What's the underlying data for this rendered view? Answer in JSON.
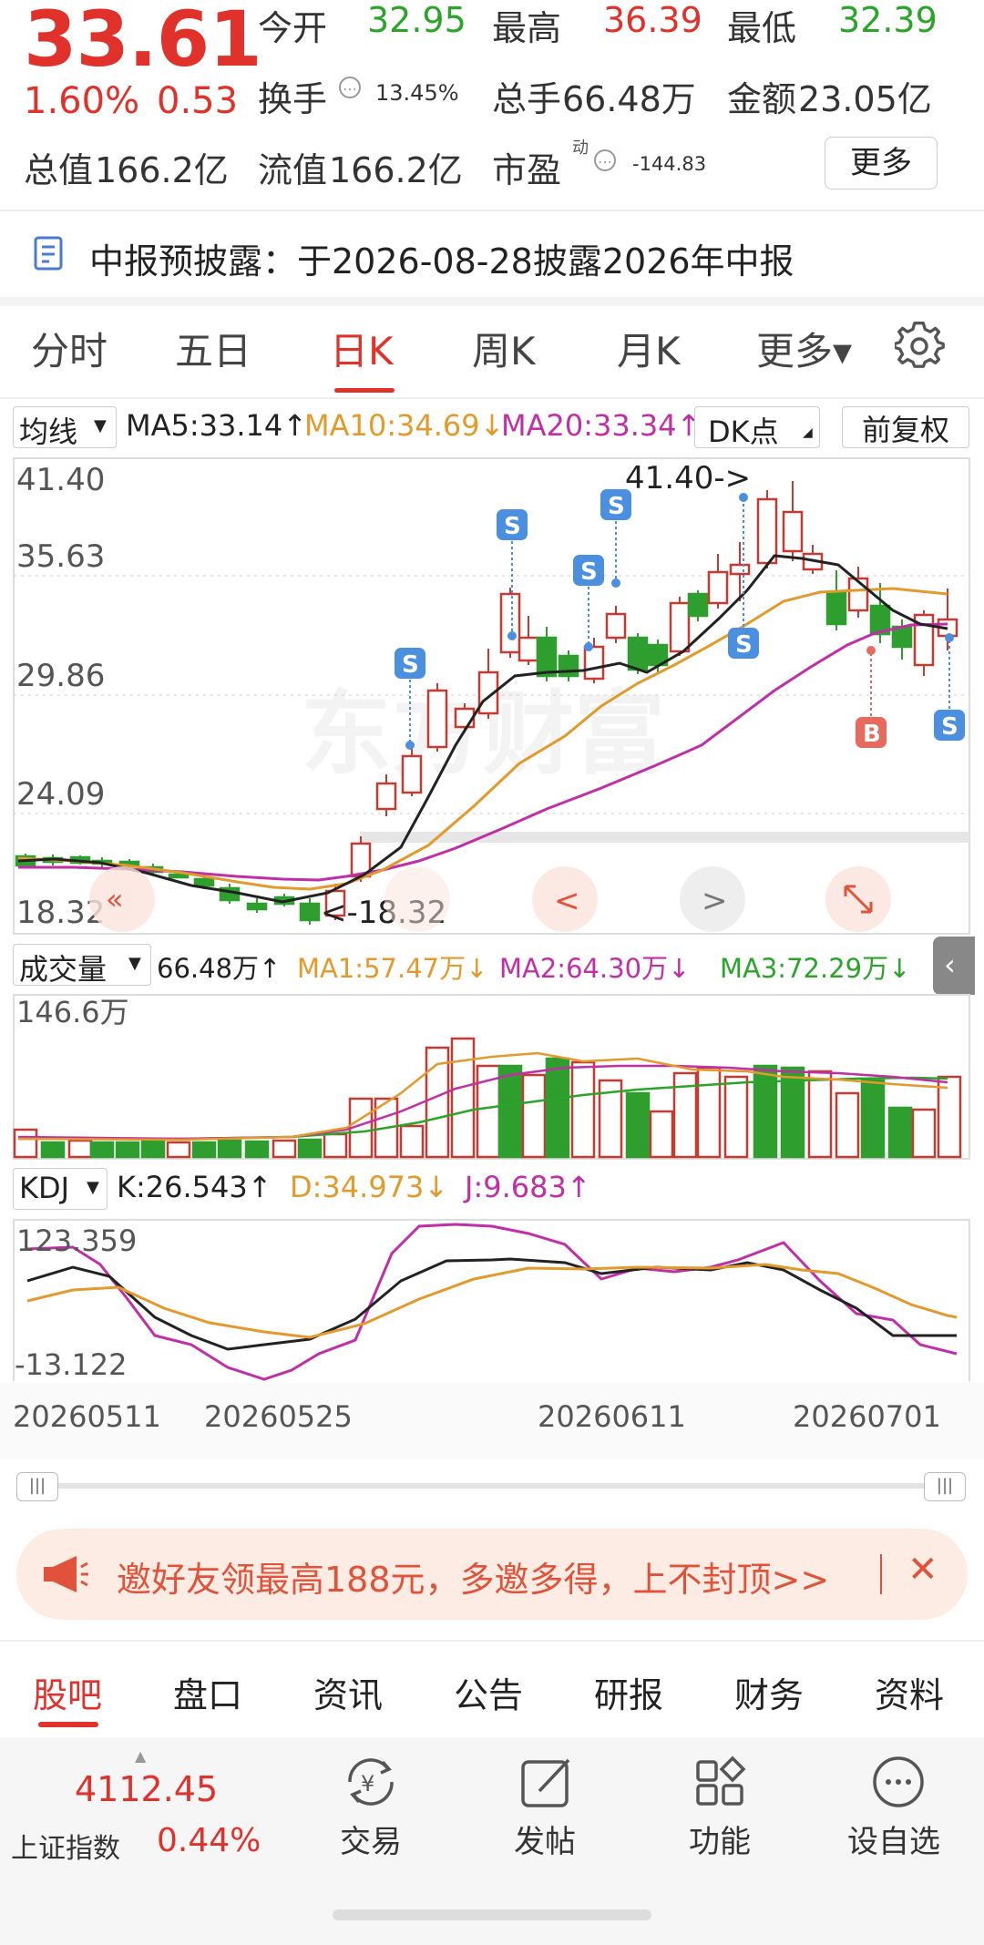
{
  "quote": {
    "price": "33.61",
    "change_pct": "1.60%",
    "change_amt": "0.53",
    "open_label": "今开",
    "open": "32.95",
    "high_label": "最高",
    "high": "36.39",
    "low_label": "最低",
    "low": "32.39",
    "turnover_label": "换手",
    "turnover": "13.45%",
    "volume_label": "总手",
    "volume": "66.48万",
    "amount_label": "金额",
    "amount": "23.05亿",
    "mktcap_label": "总值",
    "mktcap": "166.2亿",
    "float_label": "流值",
    "float_cap": "166.2亿",
    "pe_label": "市盈",
    "pe_sup": "动",
    "pe": "-144.83",
    "more_label": "更多"
  },
  "notice": {
    "text": "中报预披露：于2026-08-28披露2026年中报"
  },
  "period_tabs": [
    {
      "label": "分时"
    },
    {
      "label": "五日"
    },
    {
      "label": "日K",
      "active": true
    },
    {
      "label": "周K"
    },
    {
      "label": "月K"
    },
    {
      "label": "更多▾"
    }
  ],
  "ma_bar": {
    "selector": "均线",
    "ma5": "MA5:33.14↑",
    "ma10": "MA10:34.69↓",
    "ma20": "MA20:33.34↑",
    "dk": "DK点",
    "adjust": "前复权",
    "colors": {
      "ma5": "#222222",
      "ma10": "#e39a2c",
      "ma20": "#c02fa6"
    }
  },
  "price_chart": {
    "y_labels": [
      "41.40",
      "35.63",
      "29.86",
      "24.09",
      "18.32"
    ],
    "max_label": "41.40->",
    "min_label": "<-18.32",
    "watermark": "东方财富",
    "signal_s": "S",
    "signal_b": "B"
  },
  "vol_bar": {
    "selector": "成交量",
    "vol": "66.48万↑",
    "ma1": "MA1:57.47万↓",
    "ma2": "MA2:64.30万↓",
    "ma3": "MA3:72.29万↓",
    "y_label": "146.6万"
  },
  "kdj_bar": {
    "selector": "KDJ",
    "k": "K:26.543↑",
    "d": "D:34.973↓",
    "j": "J:9.683↑",
    "y_top": "123.359",
    "y_bottom": "-13.122"
  },
  "dates": [
    "20260511",
    "20260525",
    "20260611",
    "20260701"
  ],
  "promo": {
    "text": "邀好友领最高188元，多邀多得，上不封顶>>"
  },
  "bottom_tabs": [
    {
      "label": "股吧",
      "active": true
    },
    {
      "label": "盘口"
    },
    {
      "label": "资讯"
    },
    {
      "label": "公告"
    },
    {
      "label": "研报"
    },
    {
      "label": "财务"
    },
    {
      "label": "资料"
    }
  ],
  "index": {
    "value": "4112.45",
    "name": "上证指数",
    "change": "0.44%"
  },
  "nav": [
    {
      "label": "交易",
      "icon": "trade-icon"
    },
    {
      "label": "发帖",
      "icon": "post-icon"
    },
    {
      "label": "功能",
      "icon": "function-icon"
    },
    {
      "label": "设自选",
      "icon": "add-watchlist-icon"
    }
  ]
}
